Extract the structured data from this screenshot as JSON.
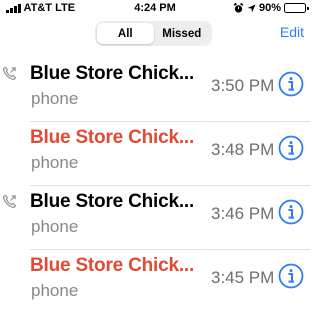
{
  "status_bar": {
    "carrier": "AT&T LTE",
    "time": "4:24 PM",
    "battery": "90%",
    "battery_level": 0.9
  },
  "segmented_control": {
    "all_label": "All",
    "missed_label": "Missed",
    "selected": "All"
  },
  "edit_label": "Edit",
  "colors": {
    "accent": "#2f7cf6",
    "missed": "#e24a33"
  },
  "calls": [
    {
      "name": "Blue Store Chick...",
      "type": "phone",
      "time": "3:50 PM",
      "missed": false
    },
    {
      "name": "Blue Store Chick...",
      "type": "phone",
      "time": "3:48 PM",
      "missed": true
    },
    {
      "name": "Blue Store Chick...",
      "type": "phone",
      "time": "3:46 PM",
      "missed": false
    },
    {
      "name": "Blue Store Chick...",
      "type": "phone",
      "time": "3:45 PM",
      "missed": true
    }
  ]
}
